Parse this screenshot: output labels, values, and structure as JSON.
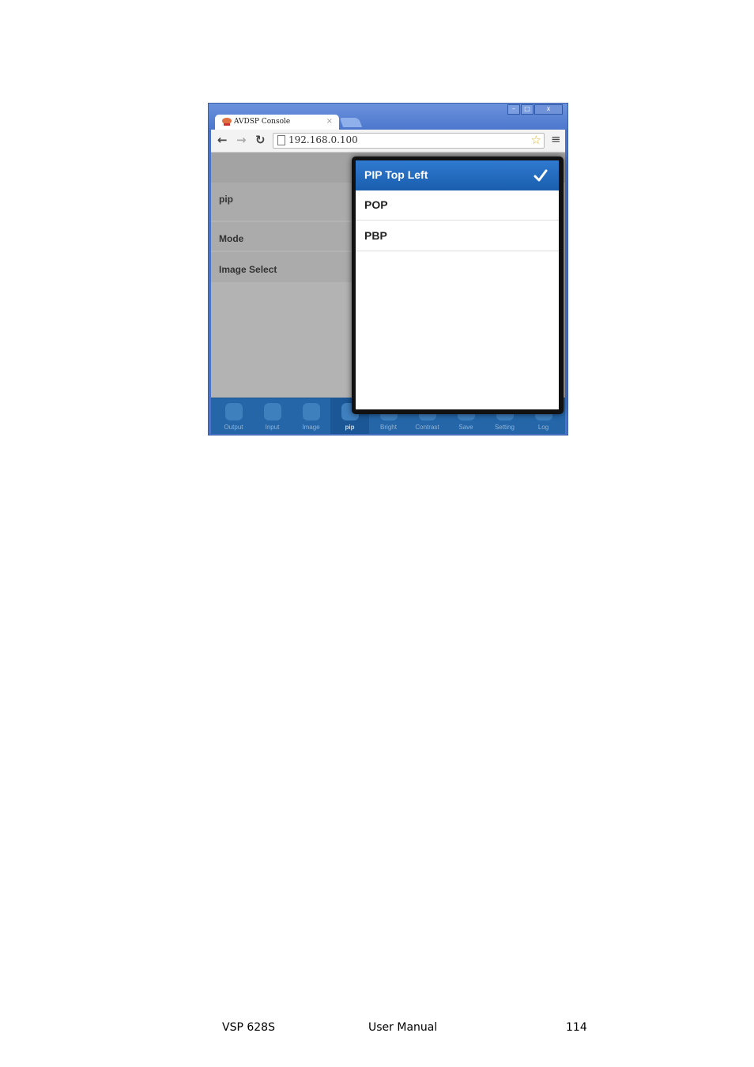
{
  "browser": {
    "tab_title": "AVDSP Console",
    "tab_close": "×",
    "url": "192.168.0.100",
    "window_buttons": [
      "–",
      "□",
      "x"
    ]
  },
  "page": {
    "rows": [
      "pip",
      "Mode",
      "Image Select"
    ]
  },
  "bottom_nav": {
    "items": [
      "Output",
      "Input",
      "Image",
      "pip",
      "Bright",
      "Contrast",
      "Save",
      "Setting",
      "Log"
    ],
    "active": "pip"
  },
  "popup": {
    "options": [
      "PIP Top Left",
      "POP",
      "PBP"
    ],
    "selected": "PIP Top Left"
  },
  "footer": {
    "product": "VSP 628S",
    "doc": "User Manual",
    "page": "114"
  },
  "colors": {
    "accent": "#1a5eae",
    "nav_bg": "#2466a8"
  }
}
